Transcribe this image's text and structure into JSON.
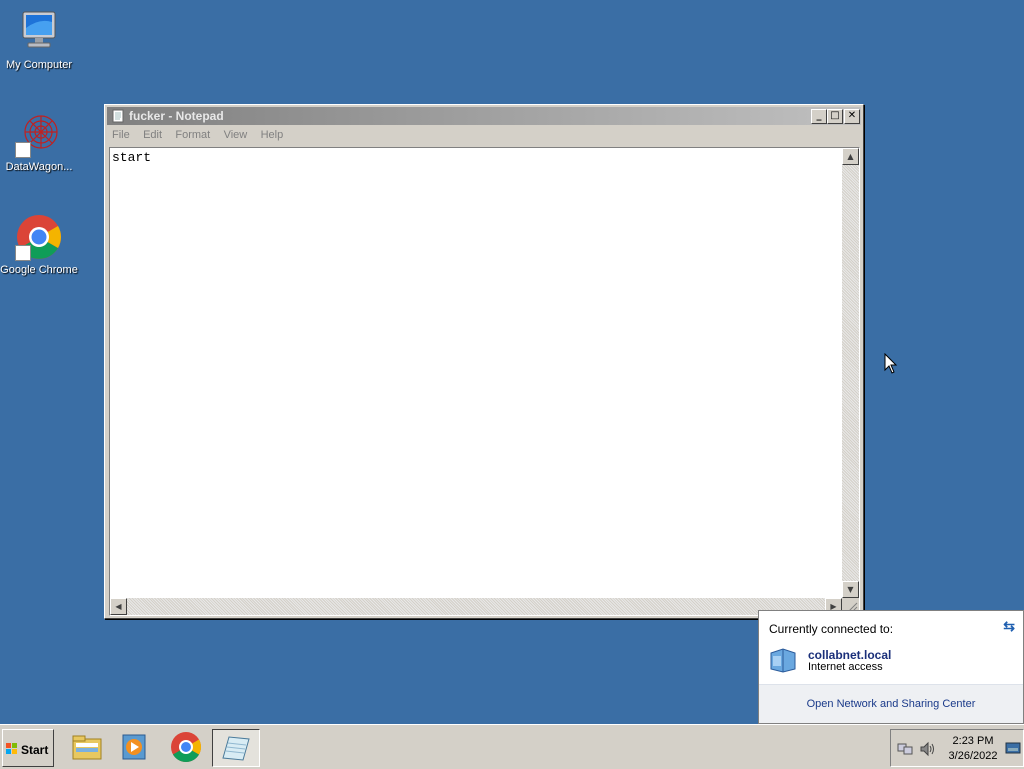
{
  "desktop": {
    "icons": [
      {
        "label": "My Computer",
        "icon": "computer-icon"
      },
      {
        "label": "DataWagon...",
        "icon": "datawagon-icon"
      },
      {
        "label": "Google Chrome",
        "icon": "chrome-icon"
      }
    ]
  },
  "notepad": {
    "title": "fucker - Notepad",
    "menu": [
      "File",
      "Edit",
      "Format",
      "View",
      "Help"
    ],
    "content": "start",
    "controls": {
      "minimize": "_",
      "maximize": "□",
      "close": "✕"
    }
  },
  "network_popup": {
    "header": "Currently connected to:",
    "network_name": "collabnet.local",
    "status": "Internet access",
    "link": "Open Network and Sharing Center"
  },
  "taskbar": {
    "start_label": "Start",
    "apps": [
      "file-explorer-icon",
      "media-player-icon",
      "chrome-icon",
      "notepad-icon"
    ],
    "clock_time": "2:23 PM",
    "clock_date": "3/26/2022"
  },
  "colors": {
    "desktop": "#3a6ea5",
    "window_face": "#d4d0c8",
    "link": "#1a3a8a"
  }
}
